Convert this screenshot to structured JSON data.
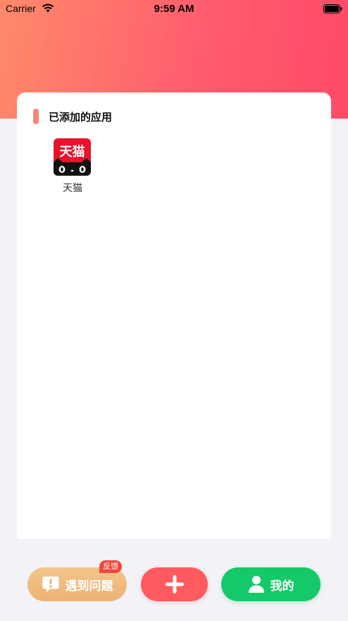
{
  "status_bar": {
    "carrier": "Carrier",
    "time": "9:59 AM"
  },
  "colors": {
    "header_gradient_start": "#FF8A6A",
    "header_gradient_end": "#FF4A68",
    "accent_bar": "#F88379",
    "problem_button": "#EDB273",
    "add_button": "#FF5A5F",
    "mine_button": "#13C96A",
    "badge": "#F2453D",
    "page_background": "#F2F2F7"
  },
  "card": {
    "title": "已添加的应用",
    "apps": [
      {
        "name": "天猫",
        "icon_text": "天猫",
        "icon": "tmall-cat-icon"
      }
    ]
  },
  "bottom_bar": {
    "problem_button": {
      "label": "遇到问题",
      "icon": "exclamation-bubble-icon",
      "badge": "反馈"
    },
    "add_button": {
      "icon": "plus-icon"
    },
    "mine_button": {
      "label": "我的",
      "icon": "person-icon"
    }
  }
}
